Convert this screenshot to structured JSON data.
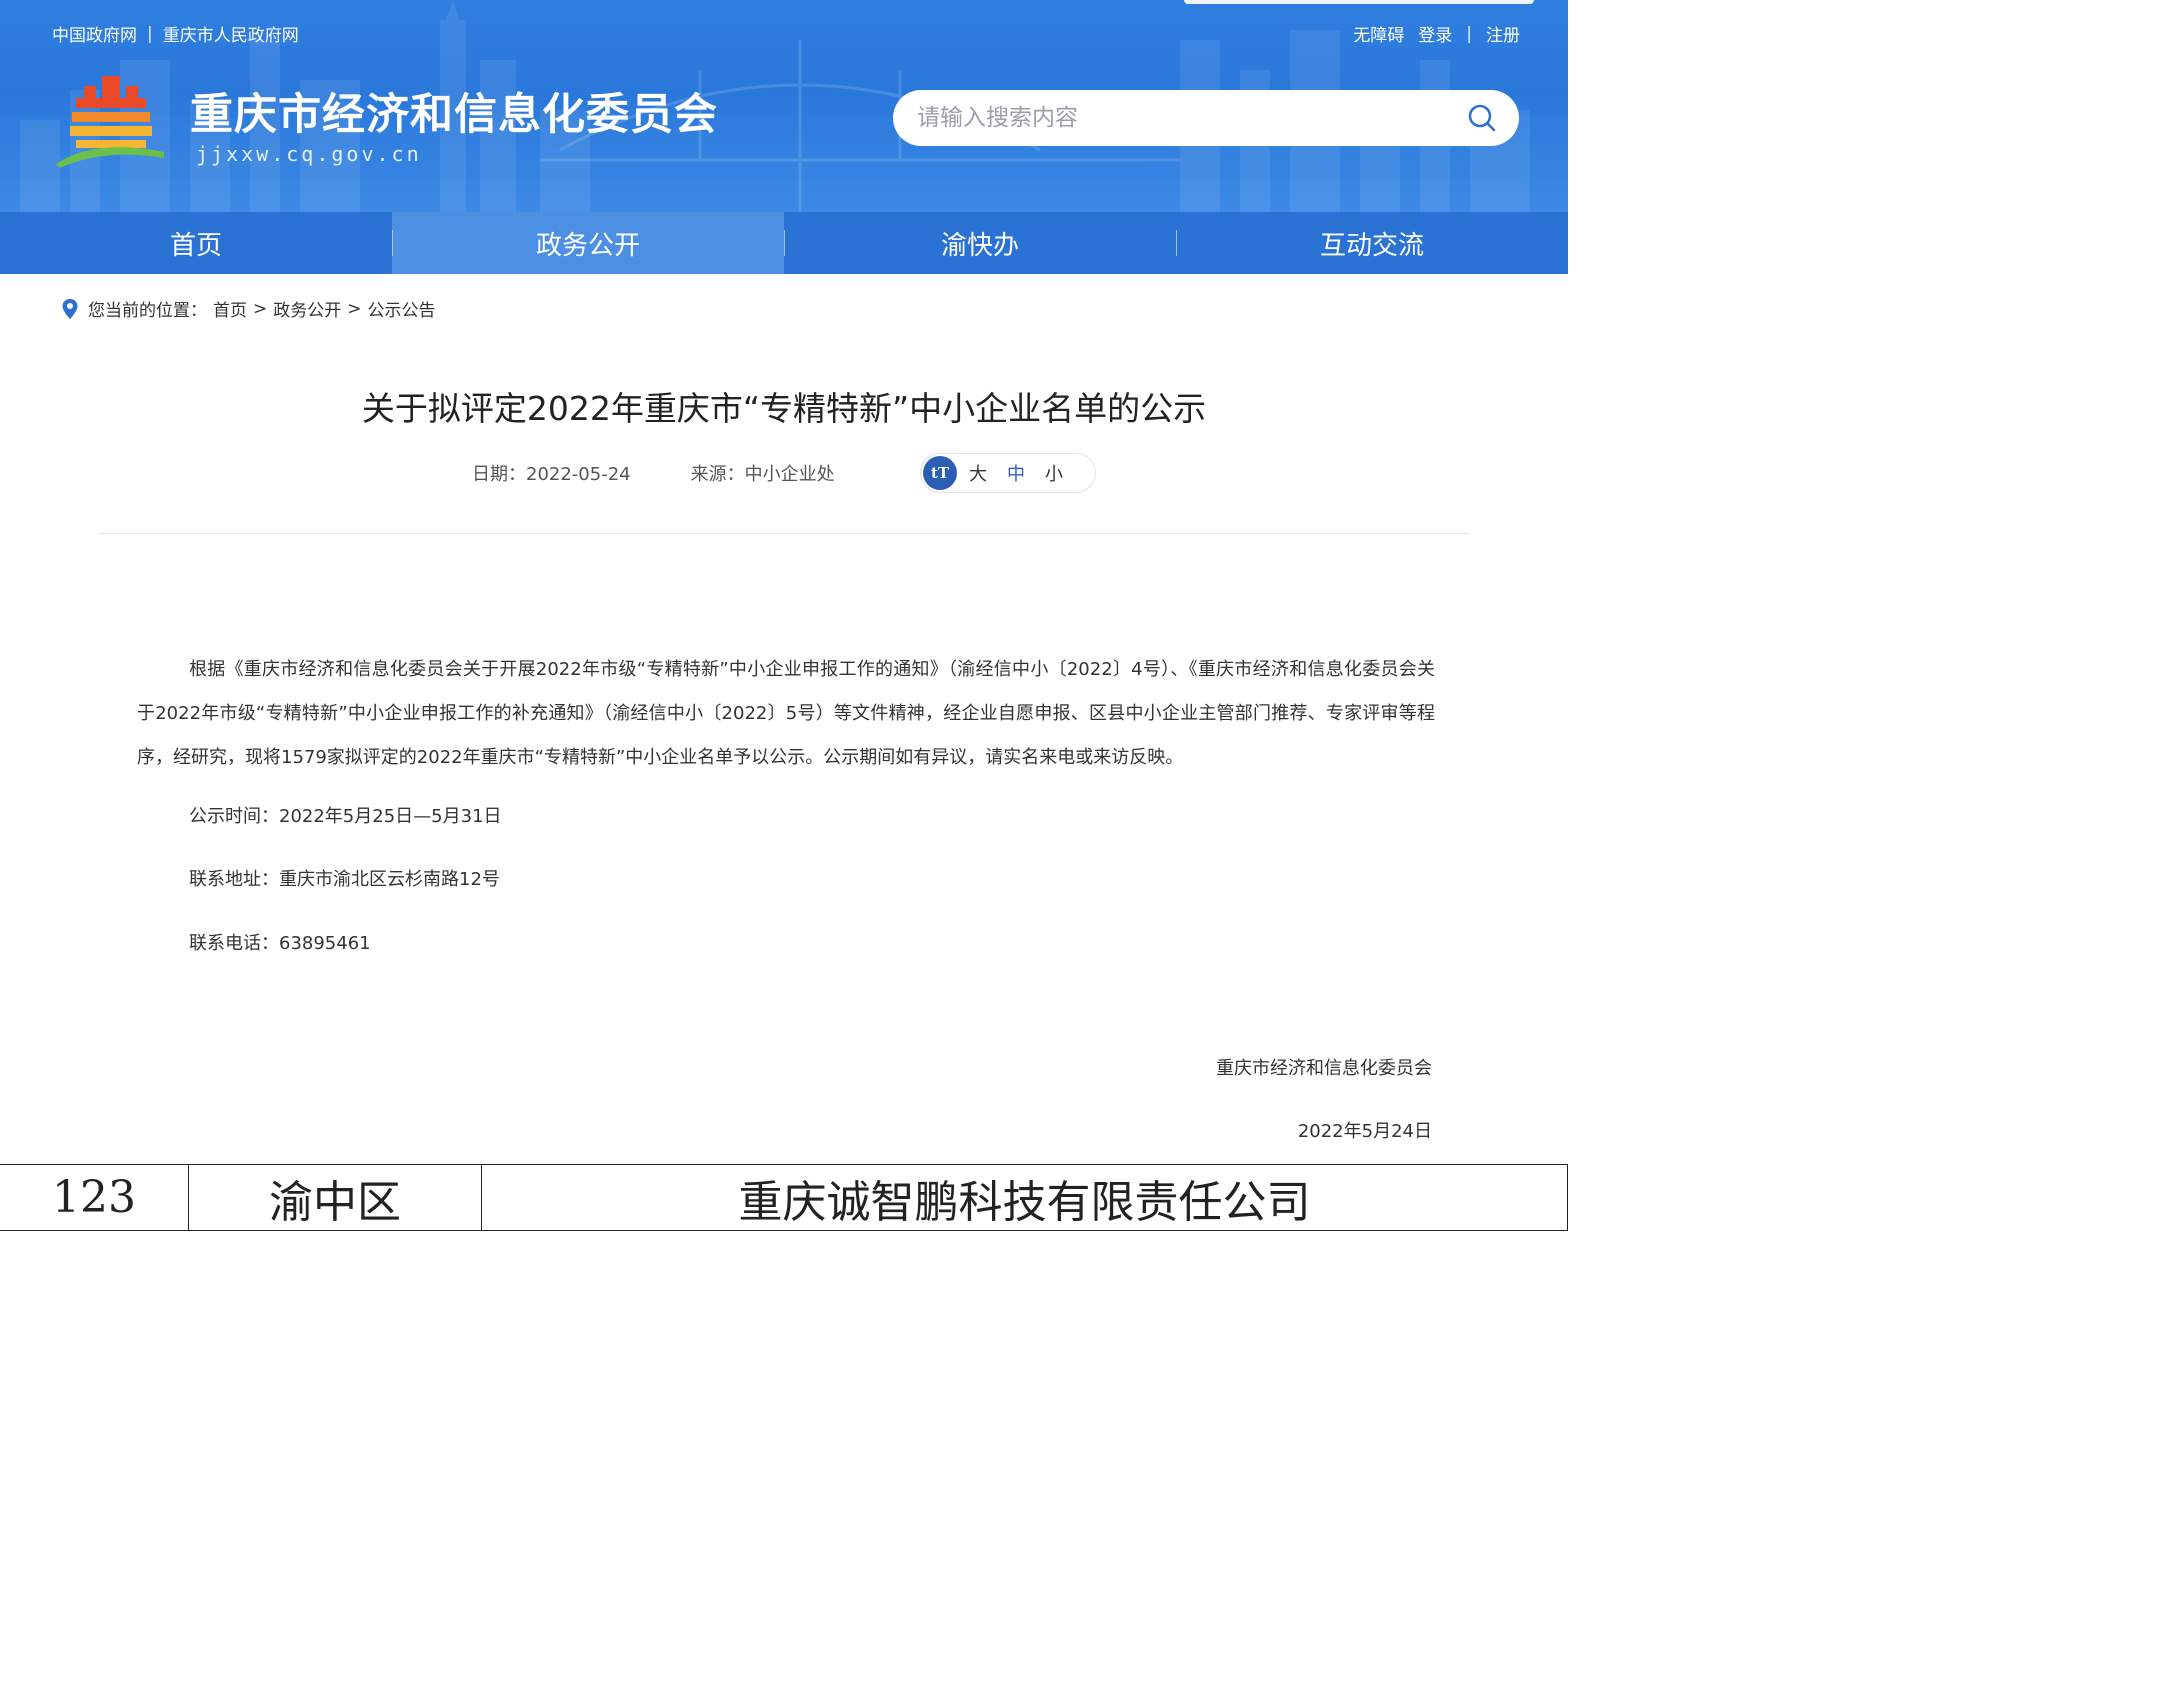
{
  "header": {
    "top_links_left": [
      "中国政府网",
      "重庆市人民政府网"
    ],
    "top_links_right": [
      "无障碍",
      "登录",
      "注册"
    ],
    "site_name": "重庆市经济和信息化委员会",
    "site_domain": "jjxxw.cq.gov.cn",
    "search": {
      "placeholder": "请输入搜索内容",
      "value": ""
    }
  },
  "nav": {
    "items": [
      "首页",
      "政务公开",
      "渝快办",
      "互动交流"
    ],
    "active": "政务公开"
  },
  "breadcrumb": {
    "prefix": "您当前的位置：",
    "items": [
      "首页",
      "政务公开",
      "公示公告"
    ],
    "separator": ">"
  },
  "article": {
    "title": "关于拟评定2022年重庆市“专精特新”中小企业名单的公示",
    "date_label": "日期：",
    "date": "2022-05-24",
    "source_label": "来源：",
    "source": "中小企业处",
    "font_size": {
      "large": "大",
      "medium": "中",
      "small": "小"
    },
    "body": "根据《重庆市经济和信息化委员会关于开展2022年市级“专精特新”中小企业申报工作的通知》（渝经信中小〔2022〕4号）、《重庆市经济和信息化委员会关于2022年市级“专精特新”中小企业申报工作的补充通知》（渝经信中小〔2022〕5号）等文件精神，经企业自愿申报、区县中小企业主管部门推荐、专家评审等程序，经研究，现将1579家拟评定的2022年重庆市“专精特新”中小企业名单予以公示。公示期间如有异议，请实名来电或来访反映。",
    "notice_time": "公示时间：2022年5月25日—5月31日",
    "address": "联系地址：重庆市渝北区云杉南路12号",
    "phone": "联系电话：63895461",
    "signature": "重庆市经济和信息化委员会",
    "sign_date": "2022年5月24日"
  },
  "table": {
    "rows": [
      [
        "123",
        "渝中区",
        "重庆诚智鹏科技有限责任公司"
      ]
    ]
  },
  "colors": {
    "header_blue": "#2a78da",
    "nav_blue": "#2a72d3",
    "nav_active": "#4d8fe2",
    "accent": "#2b5fb4"
  }
}
